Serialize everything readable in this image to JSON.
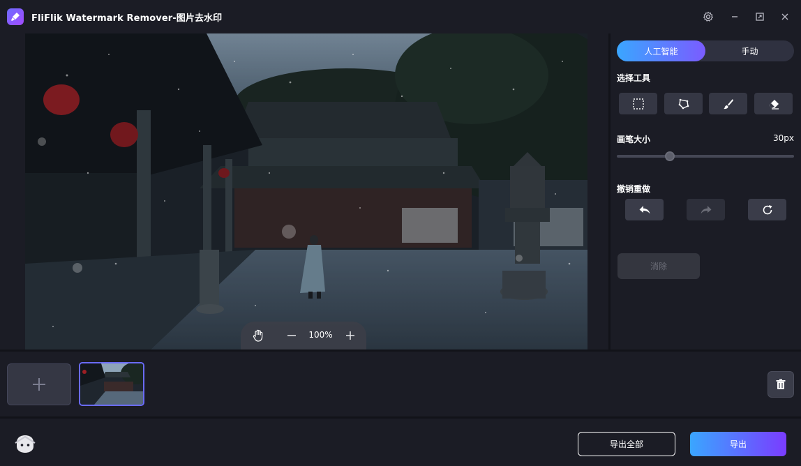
{
  "app": {
    "title": "FliFlik Watermark Remover-图片去水印",
    "logo_icon": "broom-icon"
  },
  "window_controls": [
    "settings-icon",
    "minimize-icon",
    "maximize-icon",
    "close-icon"
  ],
  "canvas": {
    "zoom_level": "100%"
  },
  "right_panel": {
    "mode_tabs": {
      "ai": "人工智能",
      "manual": "手动",
      "active": "ai"
    },
    "select_tool_label": "选择工具",
    "tools": [
      "rect-select-icon",
      "lasso-icon",
      "brush-icon",
      "eraser-icon"
    ],
    "brush_size_label": "画笔大小",
    "brush_size_value": "30px",
    "brush_size_fraction": 0.3,
    "undo_redo_label": "撤销重做",
    "clear_label": "消除"
  },
  "bottom": {
    "export_all_label": "导出全部",
    "export_label": "导出"
  },
  "colors": {
    "accent_start": "#3aa6ff",
    "accent_end": "#7a3cff",
    "background": "#1b1c25"
  }
}
